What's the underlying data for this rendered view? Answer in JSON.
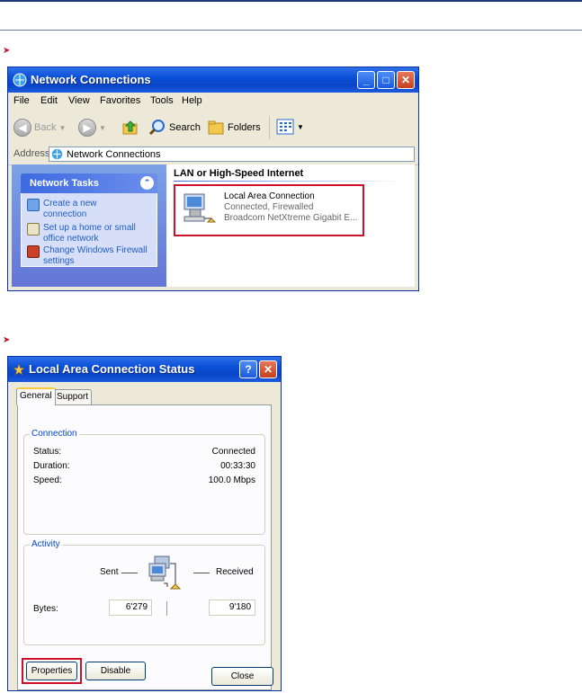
{
  "colors": {
    "xp_blue": "#0a4fd8",
    "highlight_red": "#d0102a",
    "link_blue": "#215dc6"
  },
  "window1": {
    "title": "Network Connections",
    "menu": [
      "File",
      "Edit",
      "View",
      "Favorites",
      "Tools",
      "Help"
    ],
    "toolbar": {
      "back": "Back",
      "search": "Search",
      "folders": "Folders"
    },
    "address_label": "Address",
    "address_value": "Network Connections",
    "network_tasks": {
      "title": "Network Tasks",
      "items": [
        "Create a new connection",
        "Set up a home or small office network",
        "Change Windows Firewall settings"
      ]
    },
    "group_header": "LAN or High-Speed Internet",
    "connection": {
      "name": "Local Area Connection",
      "status": "Connected, Firewalled",
      "device": "Broadcom NetXtreme Gigabit E..."
    }
  },
  "window2": {
    "title": "Local Area Connection Status",
    "tabs": [
      "General",
      "Support"
    ],
    "connection_group": "Connection",
    "rows": [
      {
        "label": "Status:",
        "value": "Connected"
      },
      {
        "label": "Duration:",
        "value": "00:33:30"
      },
      {
        "label": "Speed:",
        "value": "100.0 Mbps"
      }
    ],
    "activity_group": "Activity",
    "sent_label": "Sent",
    "received_label": "Received",
    "bytes_label": "Bytes:",
    "bytes_sent": "6'279",
    "bytes_received": "9'180",
    "buttons": {
      "properties": "Properties",
      "disable": "Disable",
      "close": "Close"
    }
  }
}
